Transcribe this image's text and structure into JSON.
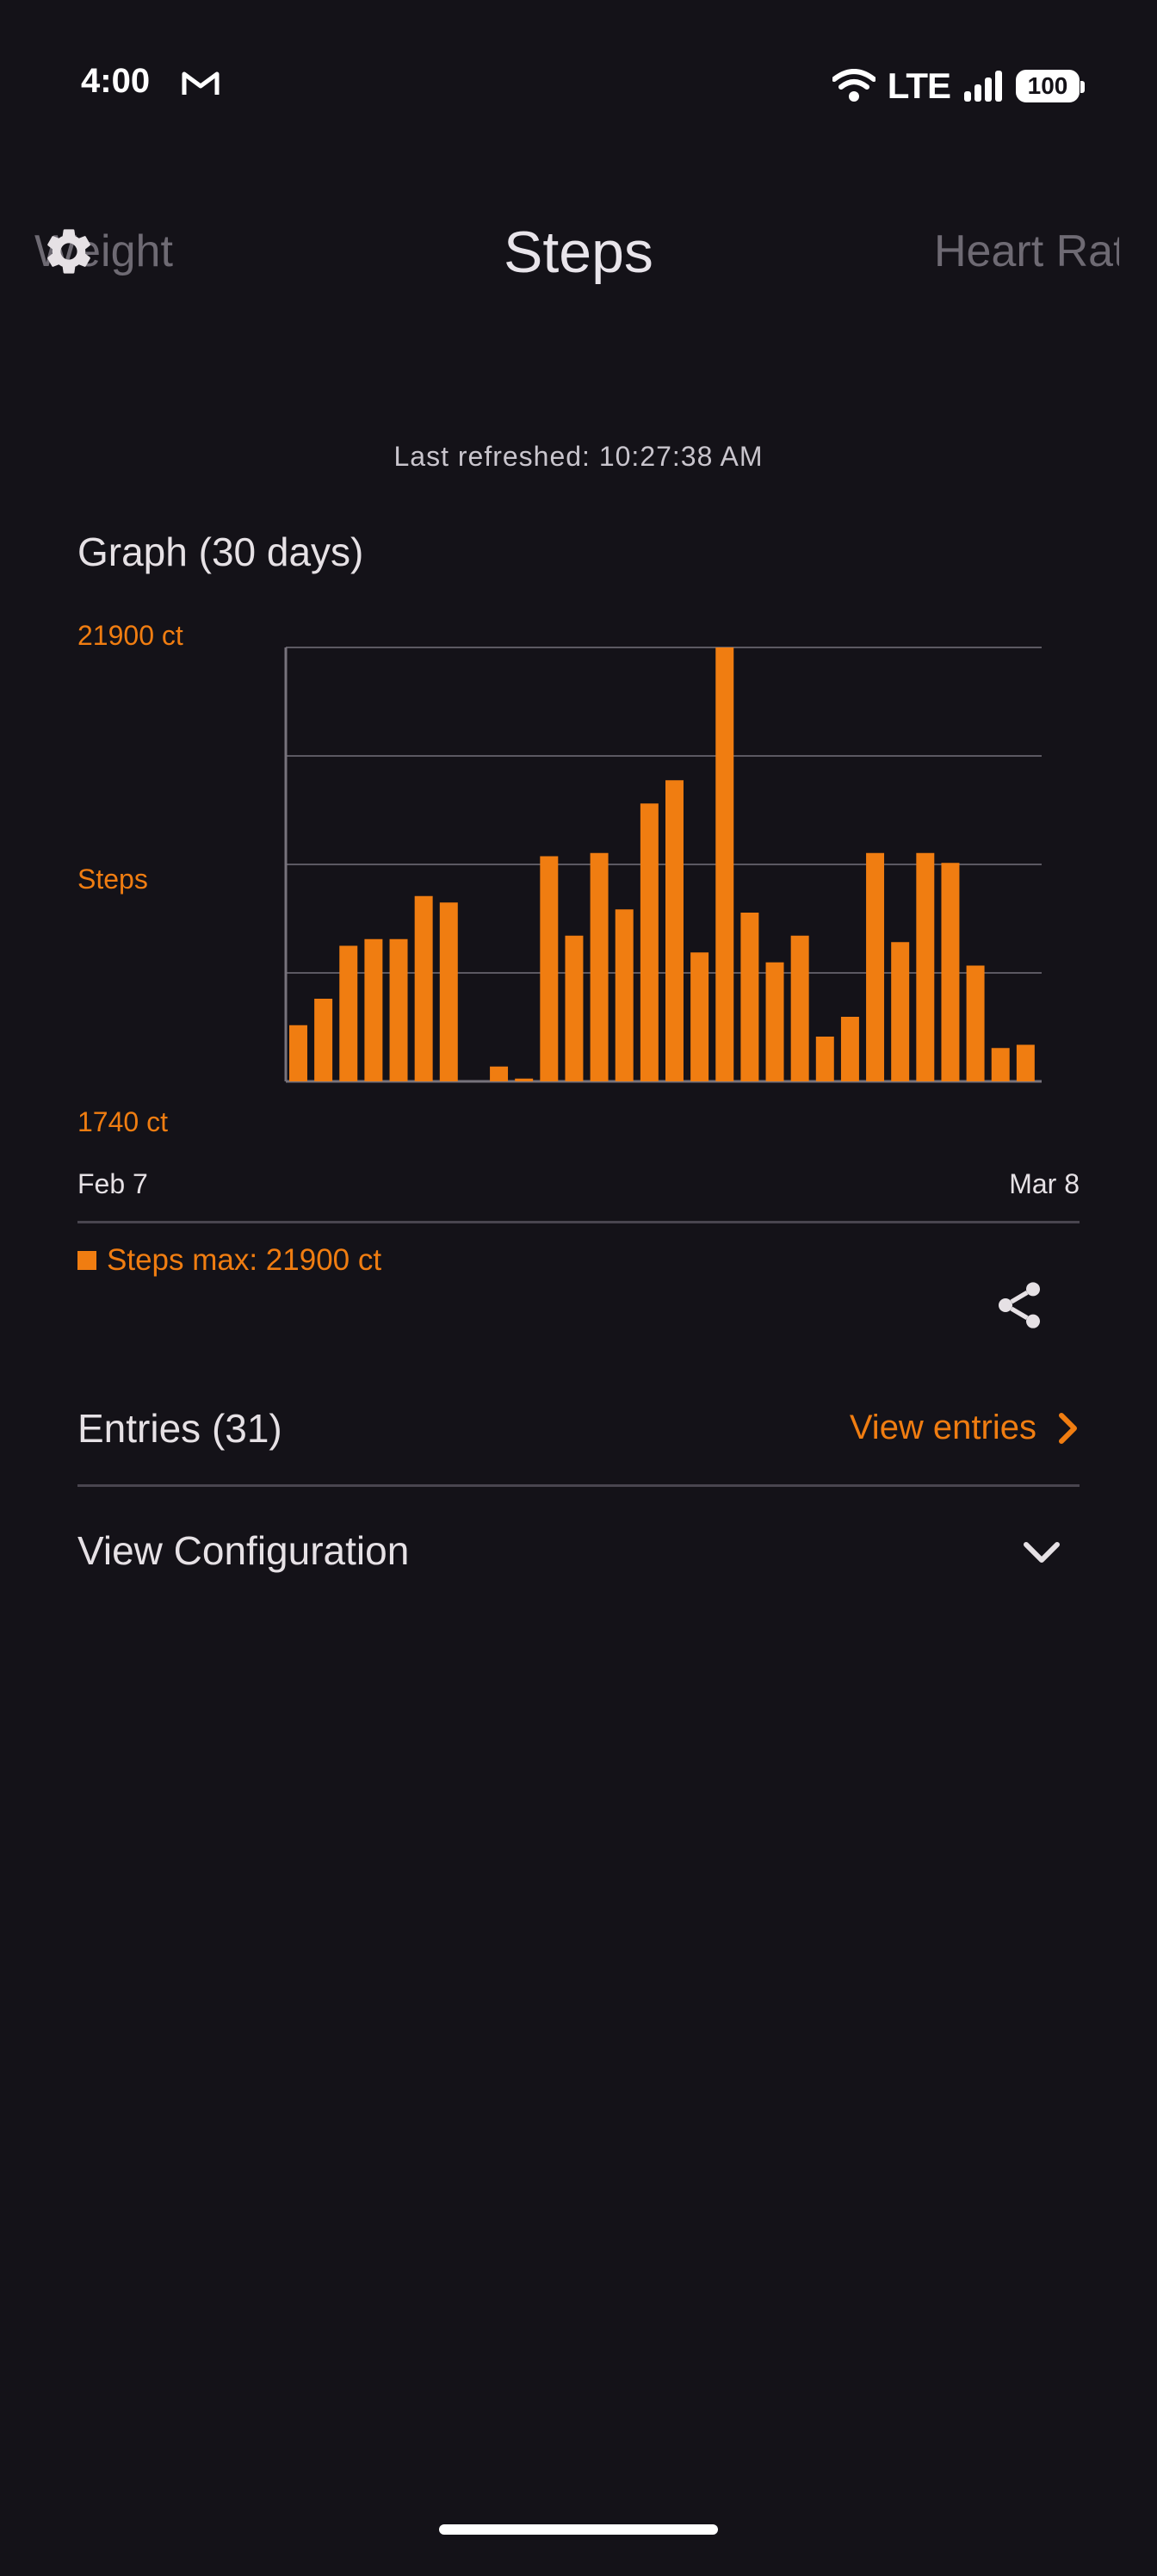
{
  "status_bar": {
    "time": "4:00",
    "network": "LTE",
    "battery": "100",
    "icons": [
      "gmail-icon",
      "wifi-icon",
      "signal-icon",
      "battery-icon"
    ]
  },
  "tabs": {
    "left": "Weight",
    "center": "Steps",
    "right": "Heart Rate"
  },
  "last_refreshed": "Last refreshed: 10:27:38 AM",
  "graph": {
    "title": "Graph (30 days)",
    "y_max_label": "21900 ct",
    "y_axis_label": "Steps",
    "y_min_label": "1740 ct",
    "x_start": "Feb 7",
    "x_end": "Mar 8",
    "legend": "Steps max: 21900 ct"
  },
  "chart_data": {
    "type": "bar",
    "ylabel": "Steps",
    "ylim": [
      1740,
      21900
    ],
    "x_range": [
      "Feb 7",
      "Mar 8"
    ],
    "grid": true,
    "values": [
      4350,
      5580,
      8040,
      8350,
      8350,
      10350,
      10050,
      null,
      2430,
      1870,
      12200,
      8510,
      12350,
      9730,
      14650,
      15730,
      7730,
      21900,
      9580,
      7270,
      8510,
      3820,
      4740,
      12350,
      8210,
      12350,
      11890,
      7120,
      3290,
      3440
    ],
    "series": [
      {
        "name": "Steps",
        "color": "#f07d11"
      }
    ]
  },
  "entries": {
    "title": "Entries (31)",
    "view_label": "View entries"
  },
  "config": {
    "title": "View Configuration"
  },
  "colors": {
    "accent": "#f07d11",
    "background": "#141218",
    "divider": "#49454f"
  }
}
